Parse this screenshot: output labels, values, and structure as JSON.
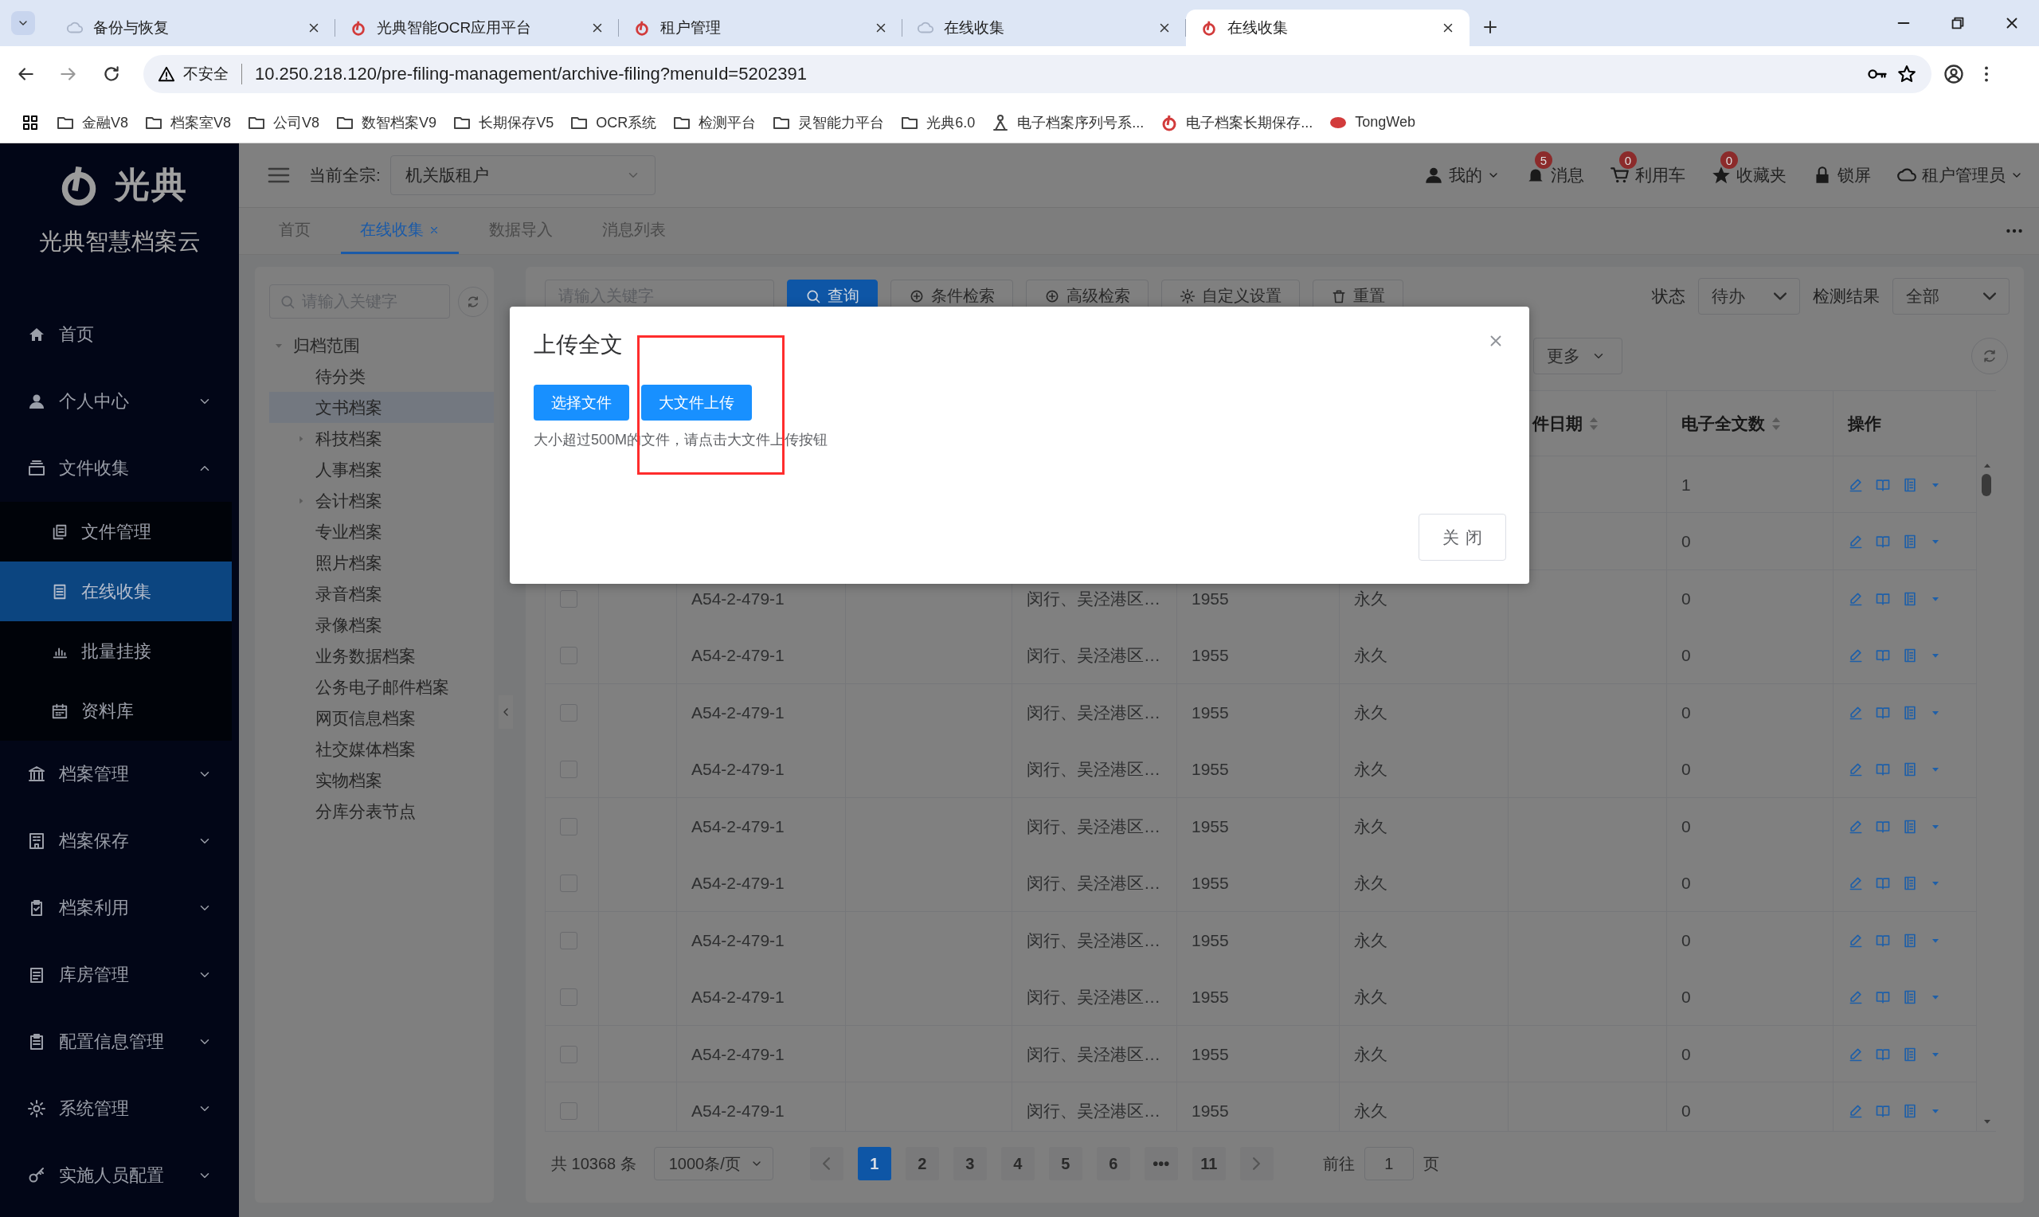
{
  "browser": {
    "tabs": [
      {
        "title": "备份与恢复",
        "selected": false
      },
      {
        "title": "光典智能OCR应用平台",
        "selected": false
      },
      {
        "title": "租户管理",
        "selected": false
      },
      {
        "title": "在线收集",
        "selected": false
      },
      {
        "title": "在线收集",
        "selected": true
      }
    ],
    "address": {
      "security": "不安全",
      "url": "10.250.218.120/pre-filing-management/archive-filing?menuId=5202391"
    },
    "bookmarks": [
      {
        "label": "金融V8",
        "kind": "folder"
      },
      {
        "label": "档案室V8",
        "kind": "folder"
      },
      {
        "label": "公司V8",
        "kind": "folder"
      },
      {
        "label": "数智档案V9",
        "kind": "folder"
      },
      {
        "label": "长期保存V5",
        "kind": "folder"
      },
      {
        "label": "OCR系统",
        "kind": "folder"
      },
      {
        "label": "检测平台",
        "kind": "folder"
      },
      {
        "label": "灵智能力平台",
        "kind": "folder"
      },
      {
        "label": "光典6.0",
        "kind": "folder"
      },
      {
        "label": "电子档案序列号系...",
        "kind": "plain"
      },
      {
        "label": "电子档案长期保存...",
        "kind": "brand"
      },
      {
        "label": "TongWeb",
        "kind": "oval"
      }
    ]
  },
  "sidebar": {
    "logo_text": "光典",
    "product": "光典智慧档案云",
    "items": [
      {
        "label": "首页",
        "kind": "link"
      },
      {
        "label": "个人中心",
        "kind": "group",
        "expanded": false
      },
      {
        "label": "文件收集",
        "kind": "group",
        "expanded": true,
        "children": [
          {
            "label": "文件管理",
            "selected": false
          },
          {
            "label": "在线收集",
            "selected": true
          },
          {
            "label": "批量挂接",
            "selected": false
          },
          {
            "label": "资料库",
            "selected": false
          }
        ]
      },
      {
        "label": "档案管理",
        "kind": "group",
        "expanded": false
      },
      {
        "label": "档案保存",
        "kind": "group",
        "expanded": false
      },
      {
        "label": "档案利用",
        "kind": "group",
        "expanded": false
      },
      {
        "label": "库房管理",
        "kind": "group",
        "expanded": false
      },
      {
        "label": "配置信息管理",
        "kind": "group",
        "expanded": false
      },
      {
        "label": "系统管理",
        "kind": "group",
        "expanded": false
      },
      {
        "label": "实施人员配置",
        "kind": "group",
        "expanded": false
      }
    ]
  },
  "header": {
    "fonds_label": "当前全宗:",
    "fonds": "机关版租户",
    "actions": [
      {
        "label": "我的",
        "kind": "menu"
      },
      {
        "label": "消息",
        "kind": "badge",
        "badge": "5"
      },
      {
        "label": "利用车",
        "kind": "badge",
        "badge": "0"
      },
      {
        "label": "收藏夹",
        "kind": "badge",
        "badge": "0"
      },
      {
        "label": "锁屏",
        "kind": "plain"
      },
      {
        "label": "租户管理员",
        "kind": "menu"
      }
    ]
  },
  "page_tabs": [
    {
      "label": "首页",
      "selected": false,
      "closable": false
    },
    {
      "label": "在线收集",
      "selected": true,
      "closable": true
    },
    {
      "label": "数据导入",
      "selected": false,
      "closable": false
    },
    {
      "label": "消息列表",
      "selected": false,
      "closable": false
    }
  ],
  "tree": {
    "placeholder": "请输入关键字",
    "root": {
      "label": "归档范围",
      "expanded": true,
      "children": [
        {
          "label": "待分类",
          "selected": false,
          "expandable": false
        },
        {
          "label": "文书档案",
          "selected": true,
          "expandable": false
        },
        {
          "label": "科技档案",
          "selected": false,
          "expandable": true
        },
        {
          "label": "人事档案",
          "selected": false,
          "expandable": false
        },
        {
          "label": "会计档案",
          "selected": false,
          "expandable": true
        },
        {
          "label": "专业档案",
          "selected": false,
          "expandable": false
        },
        {
          "label": "照片档案",
          "selected": false,
          "expandable": false
        },
        {
          "label": "录音档案",
          "selected": false,
          "expandable": false
        },
        {
          "label": "录像档案",
          "selected": false,
          "expandable": false
        },
        {
          "label": "业务数据档案",
          "selected": false,
          "expandable": false
        },
        {
          "label": "公务电子邮件档案",
          "selected": false,
          "expandable": false
        },
        {
          "label": "网页信息档案",
          "selected": false,
          "expandable": false
        },
        {
          "label": "社交媒体档案",
          "selected": false,
          "expandable": false
        },
        {
          "label": "实物档案",
          "selected": false,
          "expandable": false
        },
        {
          "label": "分库分表节点",
          "selected": false,
          "expandable": false
        }
      ]
    }
  },
  "toolbar": {
    "placeholder": "请输入关键字",
    "buttons": [
      {
        "label": "查询",
        "kind": "primary"
      },
      {
        "label": "条件检索",
        "kind": "plus"
      },
      {
        "label": "高级检索",
        "kind": "plus"
      },
      {
        "label": "自定义设置",
        "kind": "gear"
      },
      {
        "label": "重置",
        "kind": "trash"
      }
    ],
    "filters": [
      {
        "label": "状态",
        "value": "待办"
      },
      {
        "label": "检测结果",
        "value": "全部"
      }
    ],
    "more": "更多"
  },
  "table": {
    "columns": [
      {
        "label": "件日期",
        "sortable": true
      },
      {
        "label": "电子全文数",
        "sortable": true
      },
      {
        "label": "操作",
        "sortable": false
      }
    ],
    "rows": [
      {
        "file_count": "1"
      },
      {
        "file_count": "0"
      },
      {
        "checked": false,
        "column_3": "A54-2-479-1",
        "column_5": "闵行、吴泾港区…",
        "column_6": "1955",
        "column_7": "永久",
        "file_count": "0"
      },
      {
        "checked": false,
        "column_3": "A54-2-479-1",
        "column_5": "闵行、吴泾港区…",
        "column_6": "1955",
        "column_7": "永久",
        "file_count": "0"
      },
      {
        "checked": false,
        "column_3": "A54-2-479-1",
        "column_5": "闵行、吴泾港区…",
        "column_6": "1955",
        "column_7": "永久",
        "file_count": "0"
      },
      {
        "checked": false,
        "column_3": "A54-2-479-1",
        "column_5": "闵行、吴泾港区…",
        "column_6": "1955",
        "column_7": "永久",
        "file_count": "0"
      },
      {
        "checked": false,
        "column_3": "A54-2-479-1",
        "column_5": "闵行、吴泾港区…",
        "column_6": "1955",
        "column_7": "永久",
        "file_count": "0"
      },
      {
        "checked": false,
        "column_3": "A54-2-479-1",
        "column_5": "闵行、吴泾港区…",
        "column_6": "1955",
        "column_7": "永久",
        "file_count": "0"
      },
      {
        "checked": false,
        "column_3": "A54-2-479-1",
        "column_5": "闵行、吴泾港区…",
        "column_6": "1955",
        "column_7": "永久",
        "file_count": "0"
      },
      {
        "checked": false,
        "column_3": "A54-2-479-1",
        "column_5": "闵行、吴泾港区…",
        "column_6": "1955",
        "column_7": "永久",
        "file_count": "0"
      },
      {
        "checked": false,
        "column_3": "A54-2-479-1",
        "column_5": "闵行、吴泾港区…",
        "column_6": "1955",
        "column_7": "永久",
        "file_count": "0"
      },
      {
        "checked": false,
        "column_3": "A54-2-479-1",
        "column_5": "闵行、吴泾港区…",
        "column_6": "1955",
        "column_7": "永久",
        "file_count": "0"
      }
    ]
  },
  "pagination": {
    "total": "共 10368 条",
    "page_size": "1000条/页",
    "pages": [
      {
        "label": "1",
        "selected": true
      },
      {
        "label": "2",
        "selected": false
      },
      {
        "label": "3",
        "selected": false
      },
      {
        "label": "4",
        "selected": false
      },
      {
        "label": "5",
        "selected": false
      },
      {
        "label": "6",
        "selected": false
      },
      {
        "label": "•••",
        "selected": false
      },
      {
        "label": "11",
        "selected": false
      }
    ],
    "goto_label": "前往",
    "goto_value": "1",
    "goto_suffix": "页"
  },
  "modal": {
    "title": "上传全文",
    "buttons": [
      "选择文件",
      "大文件上传"
    ],
    "hint": "大小超过500M的文件，请点击大文件上传按钮",
    "close_button": "关闭"
  }
}
